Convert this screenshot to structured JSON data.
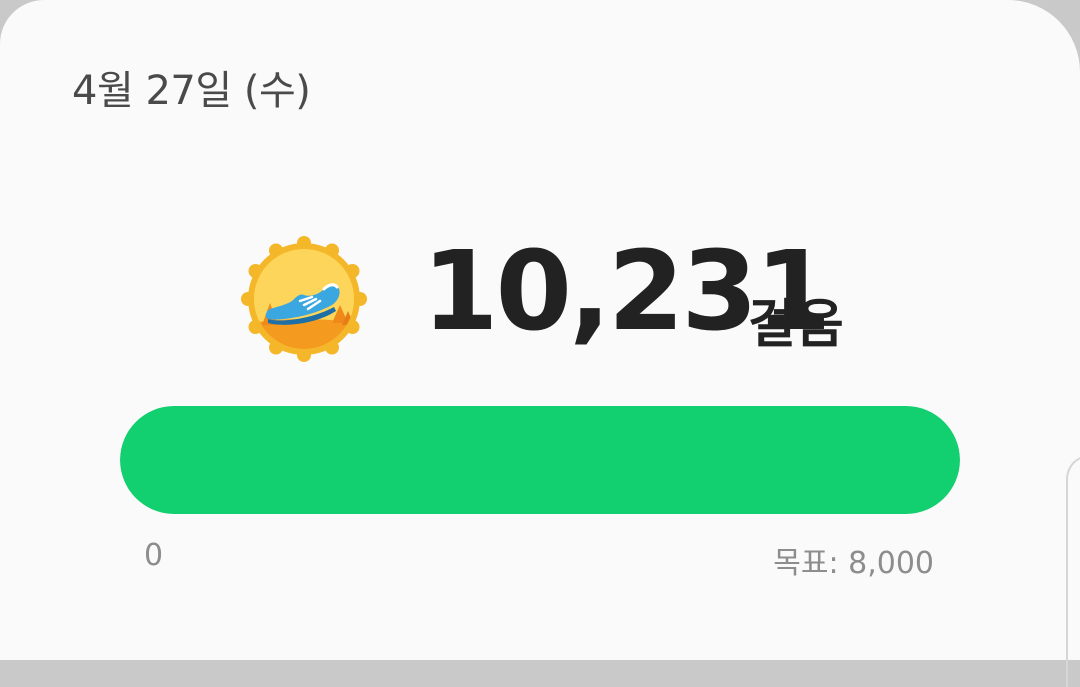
{
  "card": {
    "date": "4월 27일 (수)"
  },
  "steps": {
    "count": "10,231",
    "unit": "걸음",
    "badge_icon": "running-shoe-medal-icon",
    "count_value": 10231,
    "goal_value": 8000
  },
  "progress": {
    "fraction": 1.0,
    "fill_color": "#12cf6f",
    "min_label": "0",
    "goal_label": "목표: 8,000"
  }
}
